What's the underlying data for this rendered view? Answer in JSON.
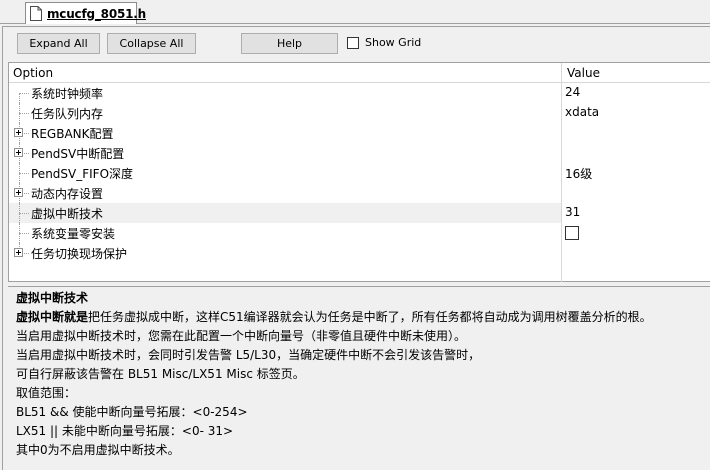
{
  "tab": {
    "label": "mcucfg_8051.h",
    "icon": "file-icon"
  },
  "toolbar": {
    "expand_all": "Expand All",
    "collapse_all": "Collapse All",
    "help": "Help",
    "show_grid": "Show Grid",
    "show_grid_checked": false
  },
  "grid": {
    "header_option": "Option",
    "header_value": "Value",
    "rows": [
      {
        "label": "系统时钟频率",
        "value": "24",
        "expandable": false
      },
      {
        "label": "任务队列内存",
        "value": "xdata",
        "expandable": false
      },
      {
        "label": "REGBANK配置",
        "value": "",
        "expandable": true
      },
      {
        "label": "PendSV中断配置",
        "value": "",
        "expandable": true
      },
      {
        "label": "PendSV_FIFO深度",
        "value": "16级",
        "expandable": false
      },
      {
        "label": "动态内存设置",
        "value": "",
        "expandable": true
      },
      {
        "label": "虚拟中断技术",
        "value": "31",
        "expandable": false,
        "selected": true
      },
      {
        "label": "系统变量零安装",
        "value": "",
        "expandable": false,
        "checkbox": true,
        "checked": false
      },
      {
        "label": "任务切换现场保护",
        "value": "",
        "expandable": true
      }
    ]
  },
  "description": {
    "title": "虚拟中断技术",
    "line1_bold": "虚拟中断就是",
    "line1_rest": "把任务虚拟成中断，这样C51编译器就会认为任务是中断了，所有任务都将自动成为调用树覆盖分析的根。",
    "line2": "当启用虚拟中断技术时，您需在此配置一个中断向量号（非零值且硬件中断未使用）。",
    "line3": "当启用虚拟中断技术时，会同时引发告警 L5/L30，当确定硬件中断不会引发该告警时，",
    "line4": "可自行屏蔽该告警在 BL51 Misc/LX51 Misc 标签页。",
    "line5": "取值范围：",
    "line6": "BL51 && 使能中断向量号拓展：<0-254>",
    "line7": "LX51 || 未能中断向量号拓展：<0- 31>",
    "line8": "其中0为不启用虚拟中断技术。"
  }
}
